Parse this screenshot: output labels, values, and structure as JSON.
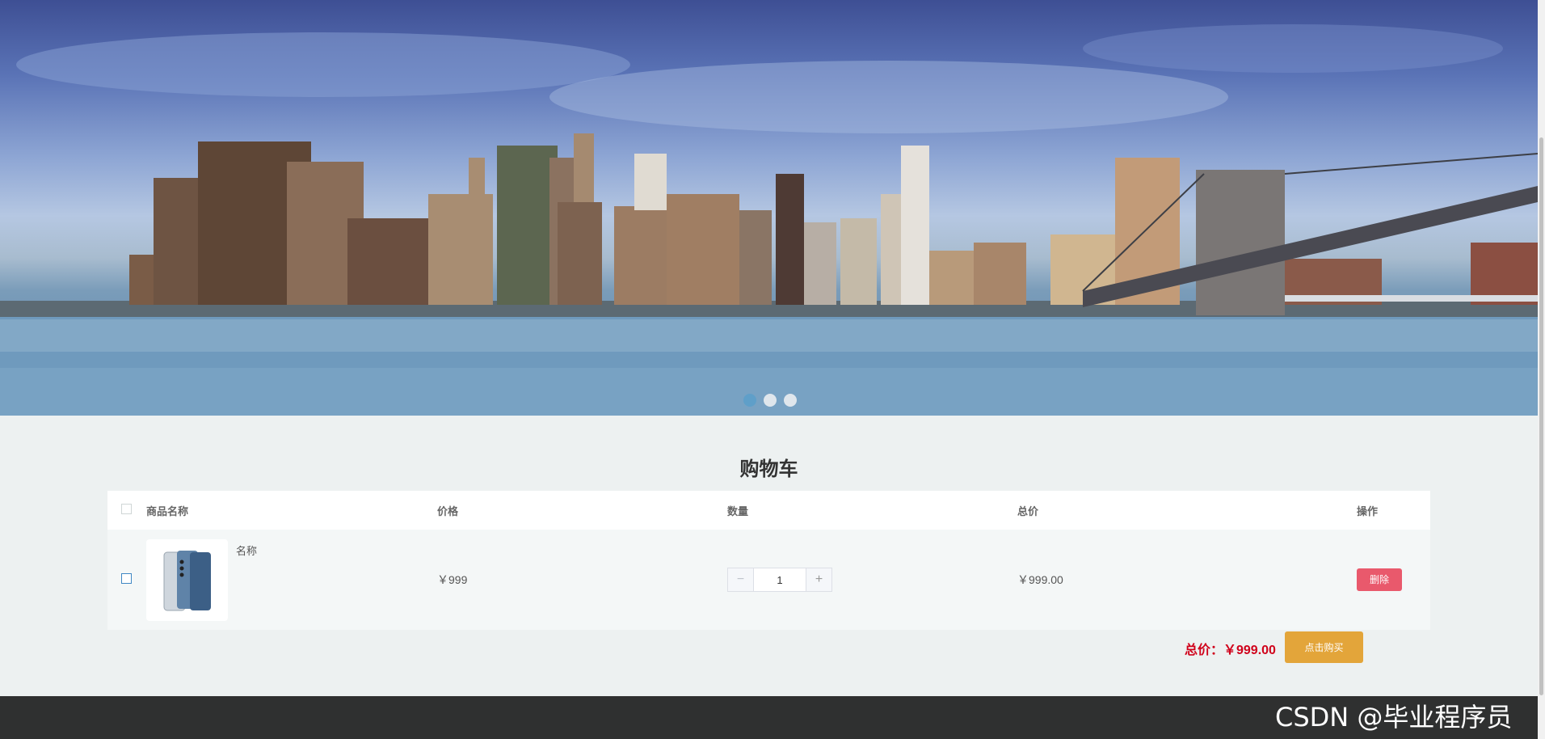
{
  "banner": {
    "slides": 3,
    "active_index": 0
  },
  "cart": {
    "title": "购物车",
    "headers": {
      "name": "商品名称",
      "price": "价格",
      "quantity": "数量",
      "total": "总价",
      "operation": "操作"
    },
    "items": [
      {
        "name": "名称",
        "price": "￥999",
        "quantity": "1",
        "total": "￥999.00",
        "delete_label": "删除"
      }
    ],
    "quantity_minus": "−",
    "quantity_plus": "+",
    "sum_label": "总价：￥999.00",
    "buy_label": "点击购买"
  },
  "watermark": "CSDN @毕业程序员",
  "colors": {
    "accent_red": "#d0021b",
    "delete_button": "#e9596c",
    "buy_button": "#e3a53a",
    "footer": "#2f3030"
  }
}
